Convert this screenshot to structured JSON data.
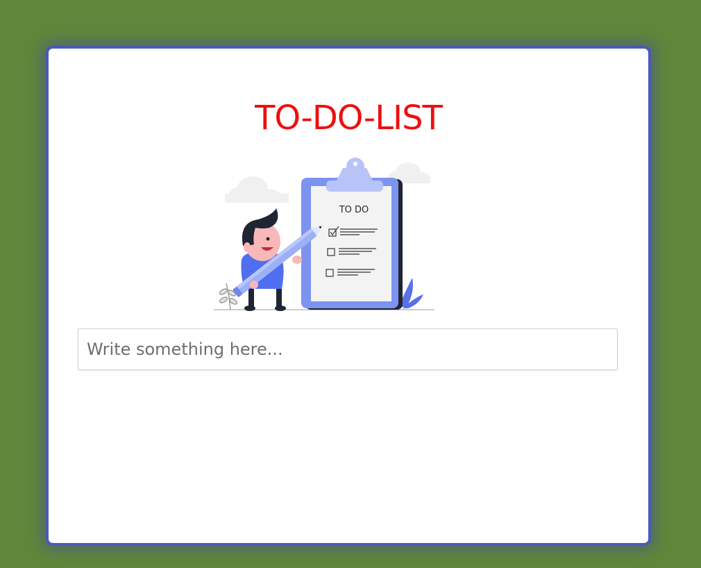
{
  "app": {
    "title": "TO-DO-LIST"
  },
  "illustration": {
    "clipboard_heading": "TO DO",
    "icon": "person-with-todo-clipboard-illustration"
  },
  "task_input": {
    "placeholder": "Write something here...",
    "value": ""
  },
  "todo_items": [],
  "colors": {
    "background": "#5e873b",
    "card_border": "#4a5bb1",
    "title": "#ee0f0f",
    "accent_blue": "#6f86ee"
  }
}
